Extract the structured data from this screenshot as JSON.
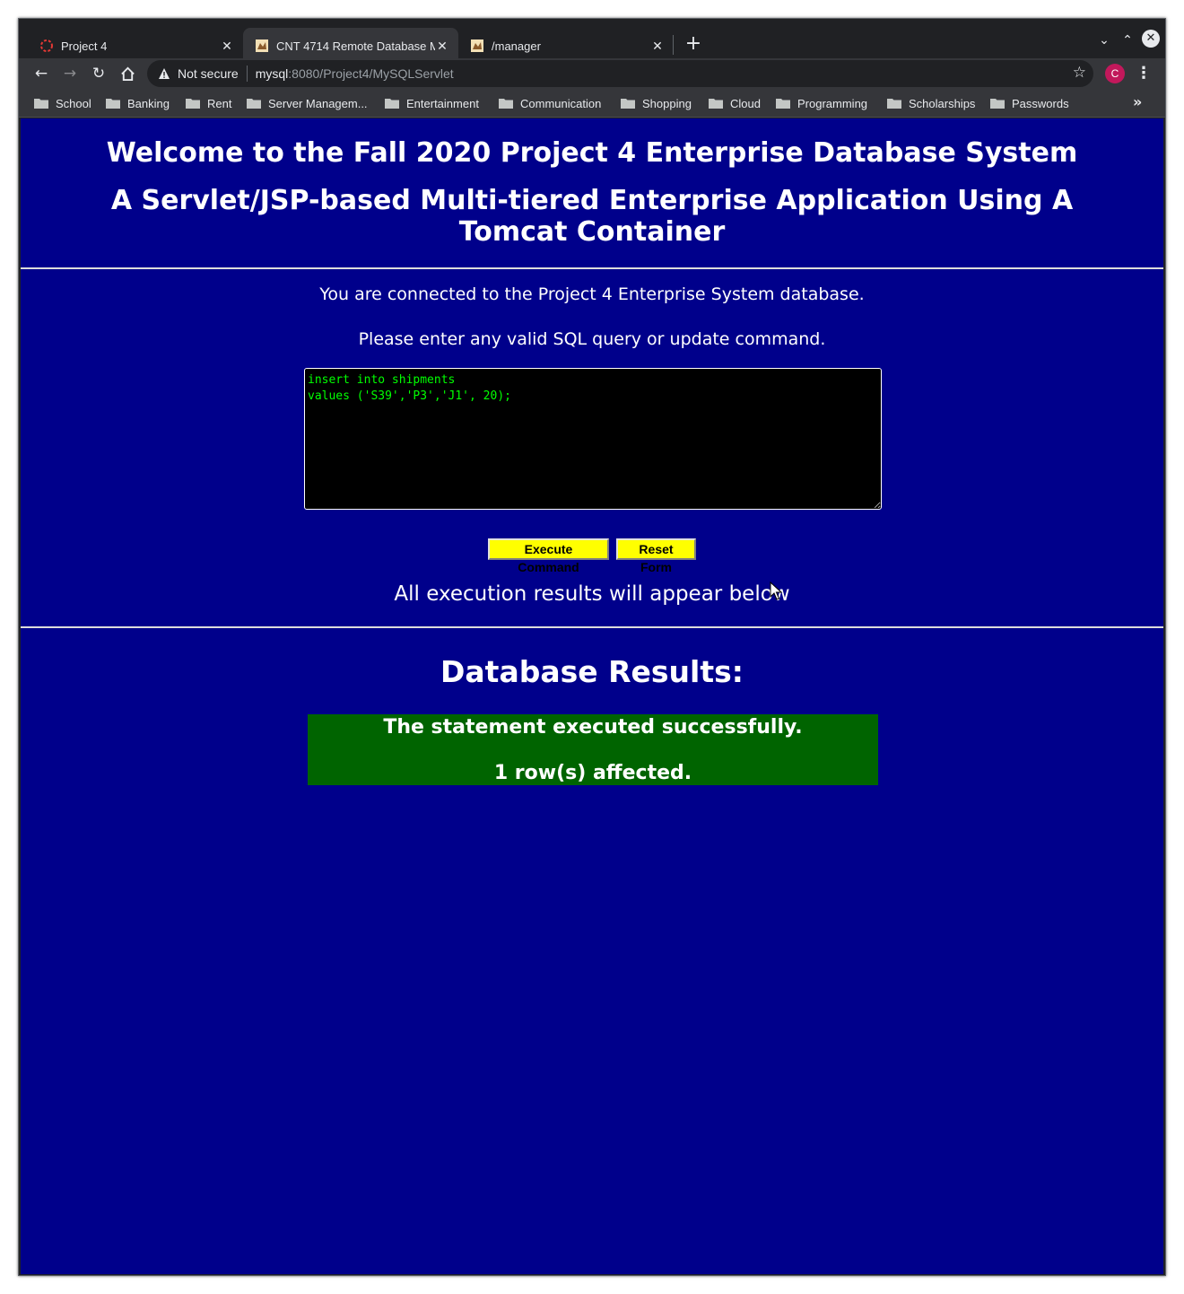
{
  "browser": {
    "tabs": [
      {
        "title": "Project 4",
        "active": false
      },
      {
        "title": "CNT 4714 Remote Database M",
        "active": true
      },
      {
        "title": "/manager",
        "active": false
      }
    ],
    "new_tab_label": "+",
    "omnibox": {
      "security_label": "Not secure",
      "host": "mysql",
      "path": ":8080/Project4/MySQLServlet"
    },
    "profile_initial": "C",
    "bookmarks": [
      "School",
      "Banking",
      "Rent",
      "Server Managem...",
      "Entertainment",
      "Communication",
      "Shopping",
      "Cloud",
      "Programming",
      "Scholarships",
      "Passwords"
    ]
  },
  "page": {
    "title": "Welcome to the Fall 2020 Project 4 Enterprise Database System",
    "subtitle": "A Servlet/JSP-based Multi-tiered Enterprise Application Using A Tomcat Container",
    "connected_text": "You are connected to the Project 4 Enterprise System database.",
    "instruction_text": "Please enter any valid SQL query or update command.",
    "sql_input": "insert into shipments\nvalues ('S39','P3','J1', 20);",
    "execute_label": "Execute Command",
    "reset_label": "Reset Form",
    "results_note": "All execution results will appear below",
    "results_heading": "Database Results:",
    "result_line1": "The statement executed successfully.",
    "result_line2": "1 row(s) affected."
  },
  "colors": {
    "page_background": "#00008b",
    "button_background": "#ffff00",
    "result_background": "#006400",
    "sql_text": "#00ff00"
  }
}
